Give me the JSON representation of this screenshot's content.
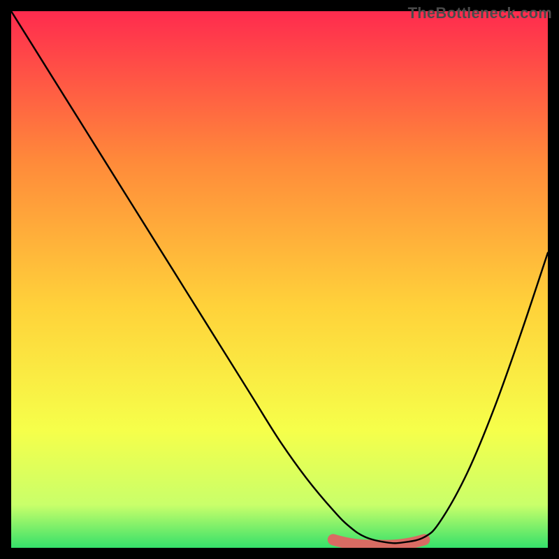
{
  "watermark": "TheBottleneck.com",
  "colors": {
    "gradient_top": "#ff2b4e",
    "gradient_upper_mid": "#ff8a3a",
    "gradient_mid": "#ffd23a",
    "gradient_lower_mid": "#f6ff4a",
    "gradient_near_bottom": "#c9ff6a",
    "gradient_bottom": "#35e06a",
    "curve": "#000000",
    "valley_highlight": "#d96b63",
    "frame": "#000000"
  },
  "chart_data": {
    "type": "line",
    "title": "",
    "xlabel": "",
    "ylabel": "",
    "xlim": [
      0,
      100
    ],
    "ylim": [
      0,
      100
    ],
    "grid": false,
    "legend": false,
    "series": [
      {
        "name": "bottleneck-curve",
        "x": [
          0,
          5,
          10,
          15,
          20,
          25,
          30,
          35,
          40,
          45,
          50,
          55,
          60,
          63,
          66,
          70,
          73,
          77,
          80,
          85,
          90,
          95,
          100
        ],
        "y": [
          100,
          92,
          84,
          76,
          68,
          60,
          52,
          44,
          36,
          28,
          20,
          13,
          7,
          4,
          2,
          1,
          1,
          2,
          5,
          14,
          26,
          40,
          55
        ]
      }
    ],
    "annotations": [
      {
        "name": "valley-highlight",
        "x_range": [
          60,
          77
        ],
        "y": 1,
        "color": "#d96b63"
      }
    ]
  }
}
